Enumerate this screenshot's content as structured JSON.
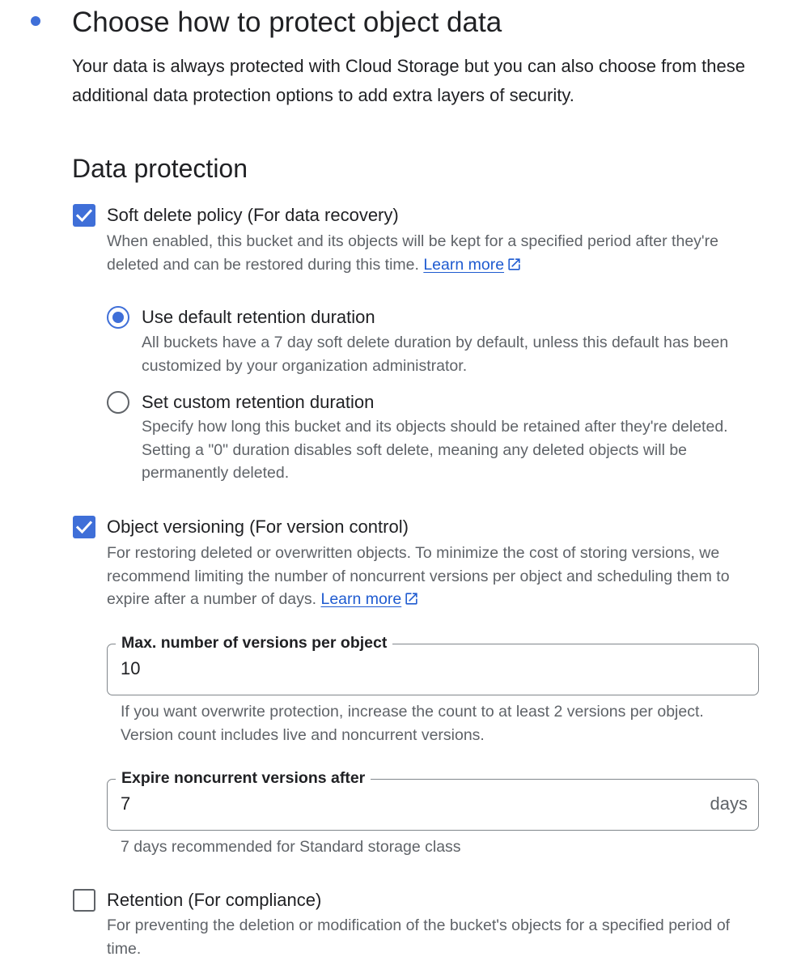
{
  "step": {
    "title": "Choose how to protect object data",
    "intro": "Your data is always protected with Cloud Storage but you can also choose from these additional data protection options to add extra layers of security."
  },
  "section": {
    "title": "Data protection"
  },
  "soft_delete": {
    "checked": true,
    "label": "Soft delete policy (For data recovery)",
    "description": "When enabled, this bucket and its objects will be kept for a specified period after they're deleted and can be restored during this time.",
    "learn_more": "Learn more",
    "options": [
      {
        "selected": true,
        "label": "Use default retention duration",
        "description": "All buckets have a 7 day soft delete duration by default, unless this default has been customized by your organization administrator."
      },
      {
        "selected": false,
        "label": "Set custom retention duration",
        "description": "Specify how long this bucket and its objects should be retained after they're deleted. Setting a \"0\" duration disables soft delete, meaning any deleted objects will be permanently deleted."
      }
    ]
  },
  "versioning": {
    "checked": true,
    "label": "Object versioning (For version control)",
    "description": "For restoring deleted or overwritten objects. To minimize the cost of storing versions, we recommend limiting the number of noncurrent versions per object and scheduling them to expire after a number of days.",
    "learn_more": "Learn more",
    "max_versions": {
      "label": "Max. number of versions per object",
      "value": "10",
      "helper": "If you want overwrite protection, increase the count to at least 2 versions per object. Version count includes live and noncurrent versions."
    },
    "expire_after": {
      "label": "Expire noncurrent versions after",
      "value": "7",
      "suffix": "days",
      "helper": "7 days recommended for Standard storage class"
    }
  },
  "retention": {
    "checked": false,
    "label": "Retention (For compliance)",
    "description": "For preventing the deletion or modification of the bucket's objects for a specified period of time."
  },
  "colors": {
    "accent": "#3f6fd8",
    "link": "#1f5bd0",
    "text_primary": "#202124",
    "text_secondary": "#5f6368",
    "field_border": "#80868b"
  }
}
